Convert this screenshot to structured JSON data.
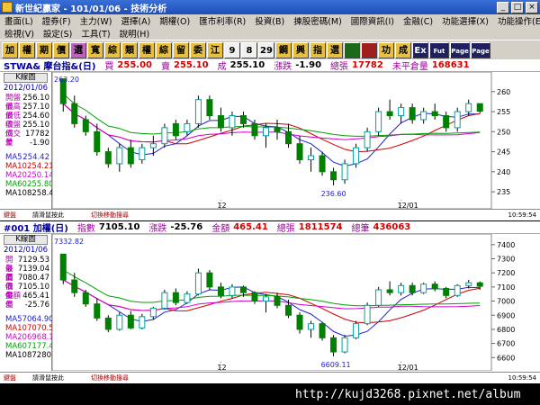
{
  "window": {
    "title": "新世紀贏家 - 101/01/06 - 技術分析"
  },
  "menu": {
    "row1": [
      "畫面(L)",
      "證券(F)",
      "主力(W)",
      "選擇(A)",
      "期權(O)",
      "匯市利率(R)",
      "投資(B)",
      "揀股密碼(M)",
      "國際資訊(I)",
      "金融(C)",
      "功能選擇(X)",
      "功能操作(E)"
    ],
    "row2": [
      "檢視(V)",
      "設定(S)",
      "工具(T)",
      "說明(H)"
    ]
  },
  "toolbar": {
    "buttons": [
      "加",
      "權",
      "期",
      "價",
      "選",
      "寬",
      "綜",
      "類",
      "權",
      "綜",
      "留",
      "委",
      "江",
      "9",
      "8",
      "29",
      "鋼",
      "興",
      "指",
      "選",
      "",
      "",
      "功",
      "成",
      "Ex",
      "Fut",
      "Page",
      "Page"
    ]
  },
  "panel1": {
    "name": "STWA& 摩台指&(日)",
    "buy_label": "買",
    "buy": "255.00",
    "sell_label": "賣",
    "sell": "255.10",
    "last_label": "成",
    "last": "255.10",
    "chg_label": "漲跌",
    "chg": "-1.90",
    "vol_label": "總張",
    "vol": "17782",
    "oi_label": "未平倉量",
    "oi": "168631",
    "tab": "K線圖",
    "date": "2012/01/06",
    "stats": [
      {
        "k": "開盤價",
        "v": "256.10"
      },
      {
        "k": "最高價",
        "v": "257.10"
      },
      {
        "k": "最低價",
        "v": "254.60"
      },
      {
        "k": "收盤價",
        "v": "255.10"
      },
      {
        "k": "成交量",
        "v": "17782"
      },
      {
        "k": "差",
        "v": "-1.90"
      }
    ],
    "ma": [
      {
        "k": "MA5",
        "v": "254.42"
      },
      {
        "k": "MA10",
        "v": "254.21"
      },
      {
        "k": "MA20",
        "v": "250.14"
      },
      {
        "k": "MA60",
        "v": "255.80"
      },
      {
        "k": "MA108",
        "v": "258.42"
      }
    ],
    "y_ticks": [
      "260",
      "255",
      "250",
      "245",
      "240",
      "235"
    ],
    "x_ticks": [
      "12",
      "12/01"
    ],
    "high_note": "263.20",
    "low_note": "236.60",
    "bottom_left": "鍵盤",
    "bottom_hint": "請滑鼠按此",
    "bottom_hint2": "切換移動搜尋",
    "bottom_right": "10:59:54"
  },
  "panel2": {
    "name": "#001 加權(日)",
    "idx_label": "指數",
    "idx": "7105.10",
    "chg_label": "漲跌",
    "chg": "-25.76",
    "amt_label": "金額",
    "amt": "465.41",
    "vol_label": "總張",
    "vol": "1811574",
    "cnt_label": "總筆",
    "cnt": "436063",
    "tab": "K線圖",
    "date": "2012/01/06",
    "stats": [
      {
        "k": "開盤價",
        "v": "7129.53"
      },
      {
        "k": "最高價",
        "v": "7139.04"
      },
      {
        "k": "最低價",
        "v": "7080.47"
      },
      {
        "k": "收盤價",
        "v": "7105.10"
      },
      {
        "k": "金額",
        "v": "465.41"
      },
      {
        "k": "差",
        "v": "-25.76"
      }
    ],
    "ma": [
      {
        "k": "MA5",
        "v": "7064.90"
      },
      {
        "k": "MA10",
        "v": "7070.57"
      },
      {
        "k": "MA20",
        "v": "6968.14"
      },
      {
        "k": "MA60",
        "v": "7177.40"
      },
      {
        "k": "MA108",
        "v": "7280.16"
      }
    ],
    "y_ticks": [
      "7400",
      "7300",
      "7200",
      "7100",
      "7000",
      "6900",
      "6800",
      "6700",
      "6600"
    ],
    "x_ticks": [
      "12",
      "12/01"
    ],
    "high_note": "7332.82",
    "low_note": "6609.11",
    "bottom_left": "鍵盤",
    "bottom_hint": "請滑鼠按此",
    "bottom_hint2": "切換移動搜尋",
    "bottom_right": "10:59:54"
  },
  "status": {
    "text": "http://kujd3268.pixnet.net/album"
  },
  "colors": {
    "up": "#d00000",
    "down": "#008000",
    "ma5": "#2020d0",
    "ma10": "#d00000",
    "ma20": "#d000d0",
    "ma60": "#00a000",
    "ma108": "#000000"
  },
  "chart_data": [
    {
      "type": "candlestick",
      "title": "STWA& 摩台指&(日)",
      "ylim": [
        233,
        264
      ],
      "y_ticks": [
        235,
        240,
        245,
        250,
        255,
        260
      ],
      "x_ticks": [
        "12",
        "12/01"
      ],
      "ohlc": [
        [
          263.2,
          263.2,
          255,
          257
        ],
        [
          257,
          259,
          251,
          252
        ],
        [
          253,
          254,
          249,
          250
        ],
        [
          250,
          252,
          244,
          245
        ],
        [
          245,
          246,
          241,
          242
        ],
        [
          242,
          247,
          240,
          246
        ],
        [
          246,
          248,
          241,
          242
        ],
        [
          243,
          247,
          242,
          246
        ],
        [
          246,
          249,
          244,
          247
        ],
        [
          247,
          252,
          246,
          251
        ],
        [
          252,
          253,
          248,
          249
        ],
        [
          250,
          253,
          249,
          252
        ],
        [
          252,
          259,
          251,
          258
        ],
        [
          258,
          259,
          253,
          254
        ],
        [
          254,
          256,
          250,
          251
        ],
        [
          251,
          255,
          249,
          254
        ],
        [
          254,
          255,
          251,
          252
        ],
        [
          252,
          253,
          248,
          249
        ],
        [
          249,
          252,
          246,
          251
        ],
        [
          251,
          253,
          248,
          250
        ],
        [
          250,
          252,
          246,
          247
        ],
        [
          247,
          249,
          242,
          243
        ],
        [
          243,
          246,
          240,
          244
        ],
        [
          244,
          245,
          239,
          240
        ],
        [
          240,
          241,
          236.6,
          238
        ],
        [
          238,
          243,
          237,
          242
        ],
        [
          242,
          247,
          241,
          246
        ],
        [
          246,
          251,
          245,
          250
        ],
        [
          250,
          256,
          249,
          255
        ],
        [
          255,
          258,
          253,
          254
        ],
        [
          254,
          257,
          252,
          256
        ],
        [
          256,
          257,
          252,
          253
        ],
        [
          253,
          256,
          252,
          255
        ],
        [
          255,
          257,
          253,
          254
        ],
        [
          254,
          255,
          250,
          251
        ],
        [
          251,
          256,
          250,
          255
        ],
        [
          255,
          258,
          254,
          257
        ],
        [
          257,
          257,
          254.6,
          255.1
        ]
      ]
    },
    {
      "type": "candlestick",
      "title": "#001 加權(日)",
      "ylim": [
        6570,
        7450
      ],
      "y_ticks": [
        6600,
        6700,
        6800,
        6900,
        7000,
        7100,
        7200,
        7300,
        7400
      ],
      "x_ticks": [
        "12",
        "12/01"
      ],
      "ohlc": [
        [
          7332.82,
          7332.82,
          7120,
          7150
        ],
        [
          7150,
          7200,
          7030,
          7060
        ],
        [
          7060,
          7080,
          6960,
          6980
        ],
        [
          6980,
          7020,
          6860,
          6880
        ],
        [
          6880,
          6900,
          6780,
          6800
        ],
        [
          6800,
          6920,
          6790,
          6900
        ],
        [
          6900,
          6930,
          6800,
          6810
        ],
        [
          6810,
          6910,
          6800,
          6890
        ],
        [
          6890,
          6960,
          6870,
          6950
        ],
        [
          6950,
          7080,
          6940,
          7060
        ],
        [
          7060,
          7090,
          6970,
          6990
        ],
        [
          6990,
          7070,
          6980,
          7050
        ],
        [
          7050,
          7230,
          7040,
          7200
        ],
        [
          7200,
          7220,
          7080,
          7100
        ],
        [
          7100,
          7130,
          7020,
          7040
        ],
        [
          7040,
          7120,
          7020,
          7100
        ],
        [
          7100,
          7110,
          7030,
          7060
        ],
        [
          7060,
          7070,
          6980,
          7000
        ],
        [
          7000,
          7050,
          6920,
          7030
        ],
        [
          7030,
          7060,
          6950,
          6970
        ],
        [
          6970,
          7010,
          6880,
          6900
        ],
        [
          6900,
          6920,
          6770,
          6800
        ],
        [
          6800,
          6860,
          6740,
          6840
        ],
        [
          6840,
          6850,
          6720,
          6740
        ],
        [
          6740,
          6760,
          6609.11,
          6640
        ],
        [
          6640,
          6760,
          6630,
          6740
        ],
        [
          6740,
          6860,
          6730,
          6840
        ],
        [
          6840,
          6990,
          6830,
          6970
        ],
        [
          6970,
          7100,
          6960,
          7080
        ],
        [
          7080,
          7140,
          7040,
          7060
        ],
        [
          7060,
          7130,
          7040,
          7110
        ],
        [
          7110,
          7130,
          7040,
          7060
        ],
        [
          7060,
          7130,
          7050,
          7120
        ],
        [
          7120,
          7140,
          7070,
          7090
        ],
        [
          7090,
          7100,
          7020,
          7040
        ],
        [
          7040,
          7120,
          7030,
          7110
        ],
        [
          7110,
          7150,
          7090,
          7130
        ],
        [
          7129.53,
          7139.04,
          7080.47,
          7105.1
        ]
      ]
    }
  ]
}
